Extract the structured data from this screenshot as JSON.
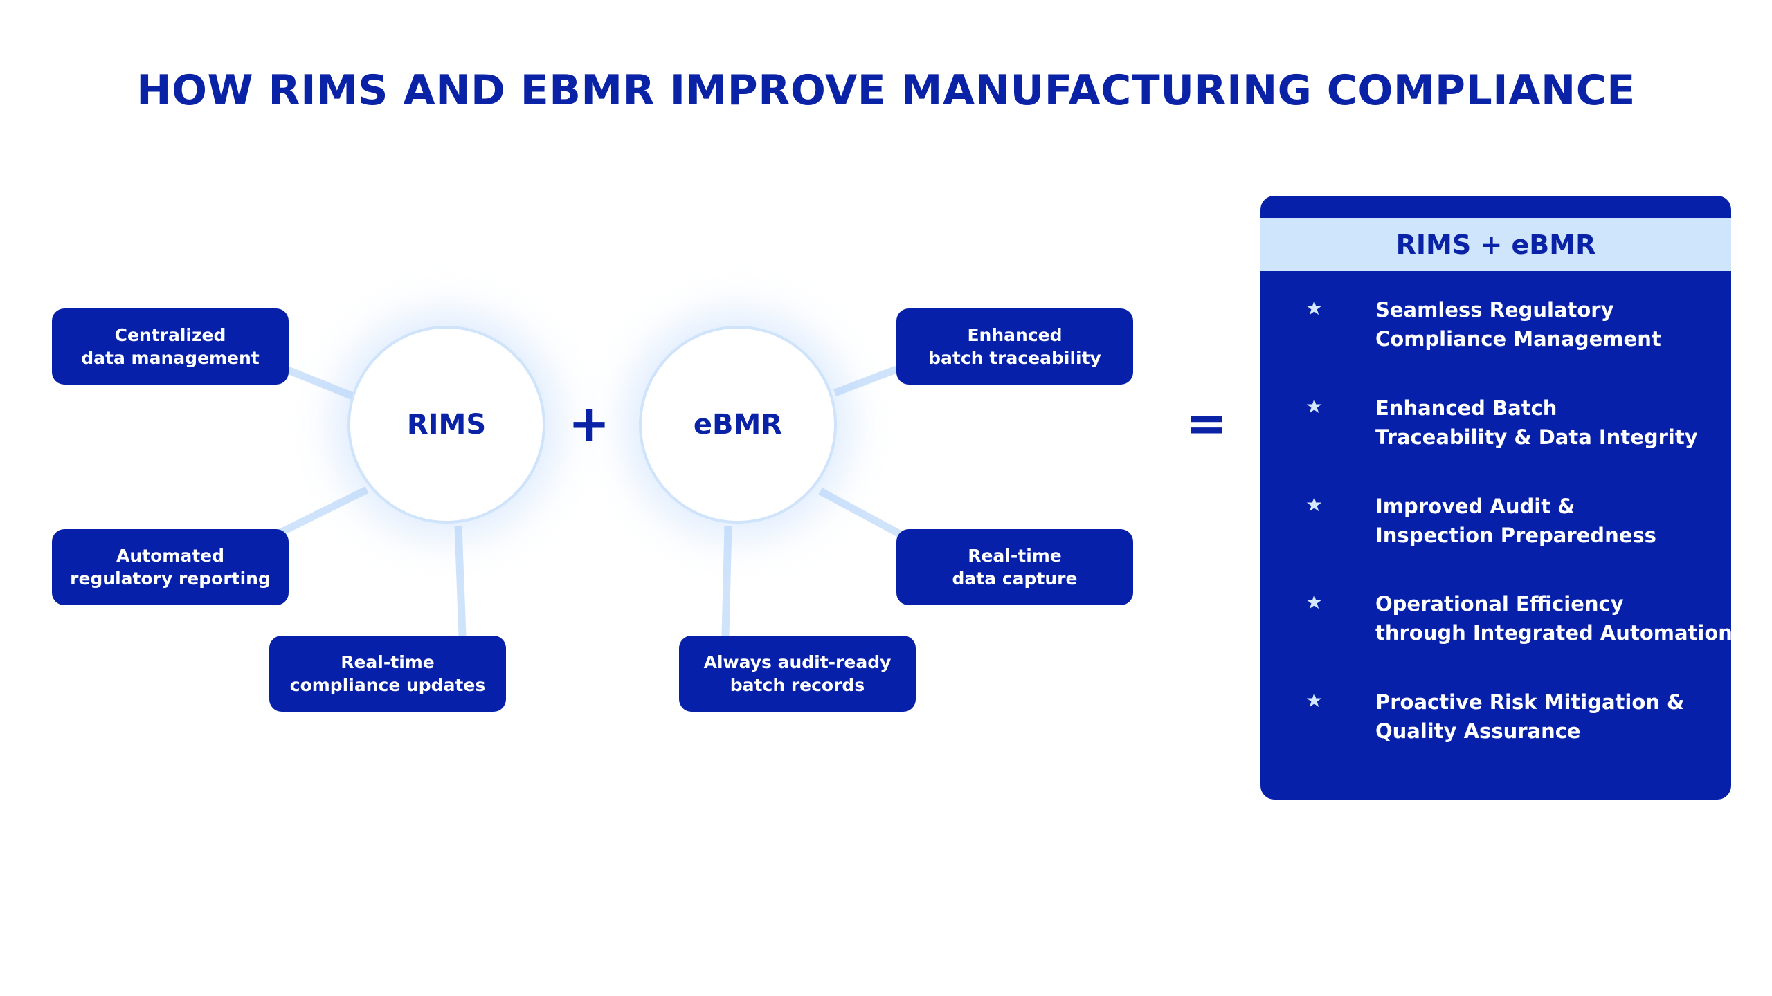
{
  "title": "HOW RIMS AND EBMR IMPROVE MANUFACTURING COMPLIANCE",
  "colors": {
    "primary": "#0620a9",
    "accent_light": "#cfe5fb",
    "connector": "#cfe3fb",
    "background": "#ffffff"
  },
  "operators": {
    "plus": "+",
    "equals": "="
  },
  "rims": {
    "label": "RIMS",
    "features": [
      {
        "line1": "Centralized",
        "line2": "data management"
      },
      {
        "line1": "Automated",
        "line2": "regulatory reporting"
      },
      {
        "line1": "Real-time",
        "line2": "compliance updates"
      }
    ]
  },
  "ebmr": {
    "label": "eBMR",
    "features": [
      {
        "line1": "Enhanced",
        "line2": "batch traceability"
      },
      {
        "line1": "Real-time",
        "line2": "data capture"
      },
      {
        "line1": "Always audit-ready",
        "line2": "batch records"
      }
    ]
  },
  "result": {
    "heading": "RIMS + eBMR",
    "bullet_icon": "star-icon",
    "benefits": [
      {
        "line1": "Seamless Regulatory",
        "line2": "Compliance Management"
      },
      {
        "line1": "Enhanced Batch",
        "line2": "Traceability & Data Integrity"
      },
      {
        "line1": "Improved Audit &",
        "line2": "Inspection Preparedness"
      },
      {
        "line1": "Operational Efficiency",
        "line2": "through Integrated Automation"
      },
      {
        "line1": "Proactive Risk Mitigation &",
        "line2": "Quality Assurance"
      }
    ]
  }
}
